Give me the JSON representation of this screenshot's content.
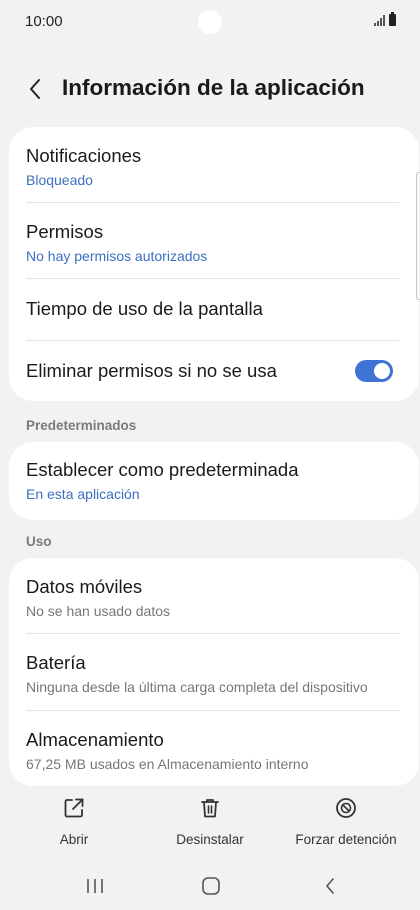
{
  "status_bar": {
    "time": "10:00"
  },
  "header": {
    "title": "Información de la aplicación"
  },
  "card1": {
    "notifications": {
      "label": "Notificaciones",
      "value": "Bloqueado"
    },
    "permissions": {
      "label": "Permisos",
      "value": "No hay permisos autorizados"
    },
    "screen_time": {
      "label": "Tiempo de uso de la pantalla"
    },
    "remove_permissions": {
      "label": "Eliminar permisos si no se usa",
      "enabled": true
    }
  },
  "defaults_section": {
    "heading": "Predeterminados",
    "set_default": {
      "label": "Establecer como predeterminada",
      "value": "En esta aplicación"
    }
  },
  "usage_section": {
    "heading": "Uso",
    "mobile_data": {
      "label": "Datos móviles",
      "value": "No se han usado datos"
    },
    "battery": {
      "label": "Batería",
      "value": "Ninguna desde la última carga completa del dispositivo"
    },
    "storage": {
      "label": "Almacenamiento",
      "value": "67,25 MB usados en Almacenamiento interno"
    }
  },
  "actions": {
    "open": {
      "label": "Abrir",
      "icon": "open-external-icon"
    },
    "uninstall": {
      "label": "Desinstalar",
      "icon": "trash-icon"
    },
    "force_stop": {
      "label": "Forzar detención",
      "icon": "stop-circle-icon"
    }
  },
  "colors": {
    "accent": "#3f74d6",
    "link": "#3c6fbf",
    "background": "#f2f2f2"
  }
}
